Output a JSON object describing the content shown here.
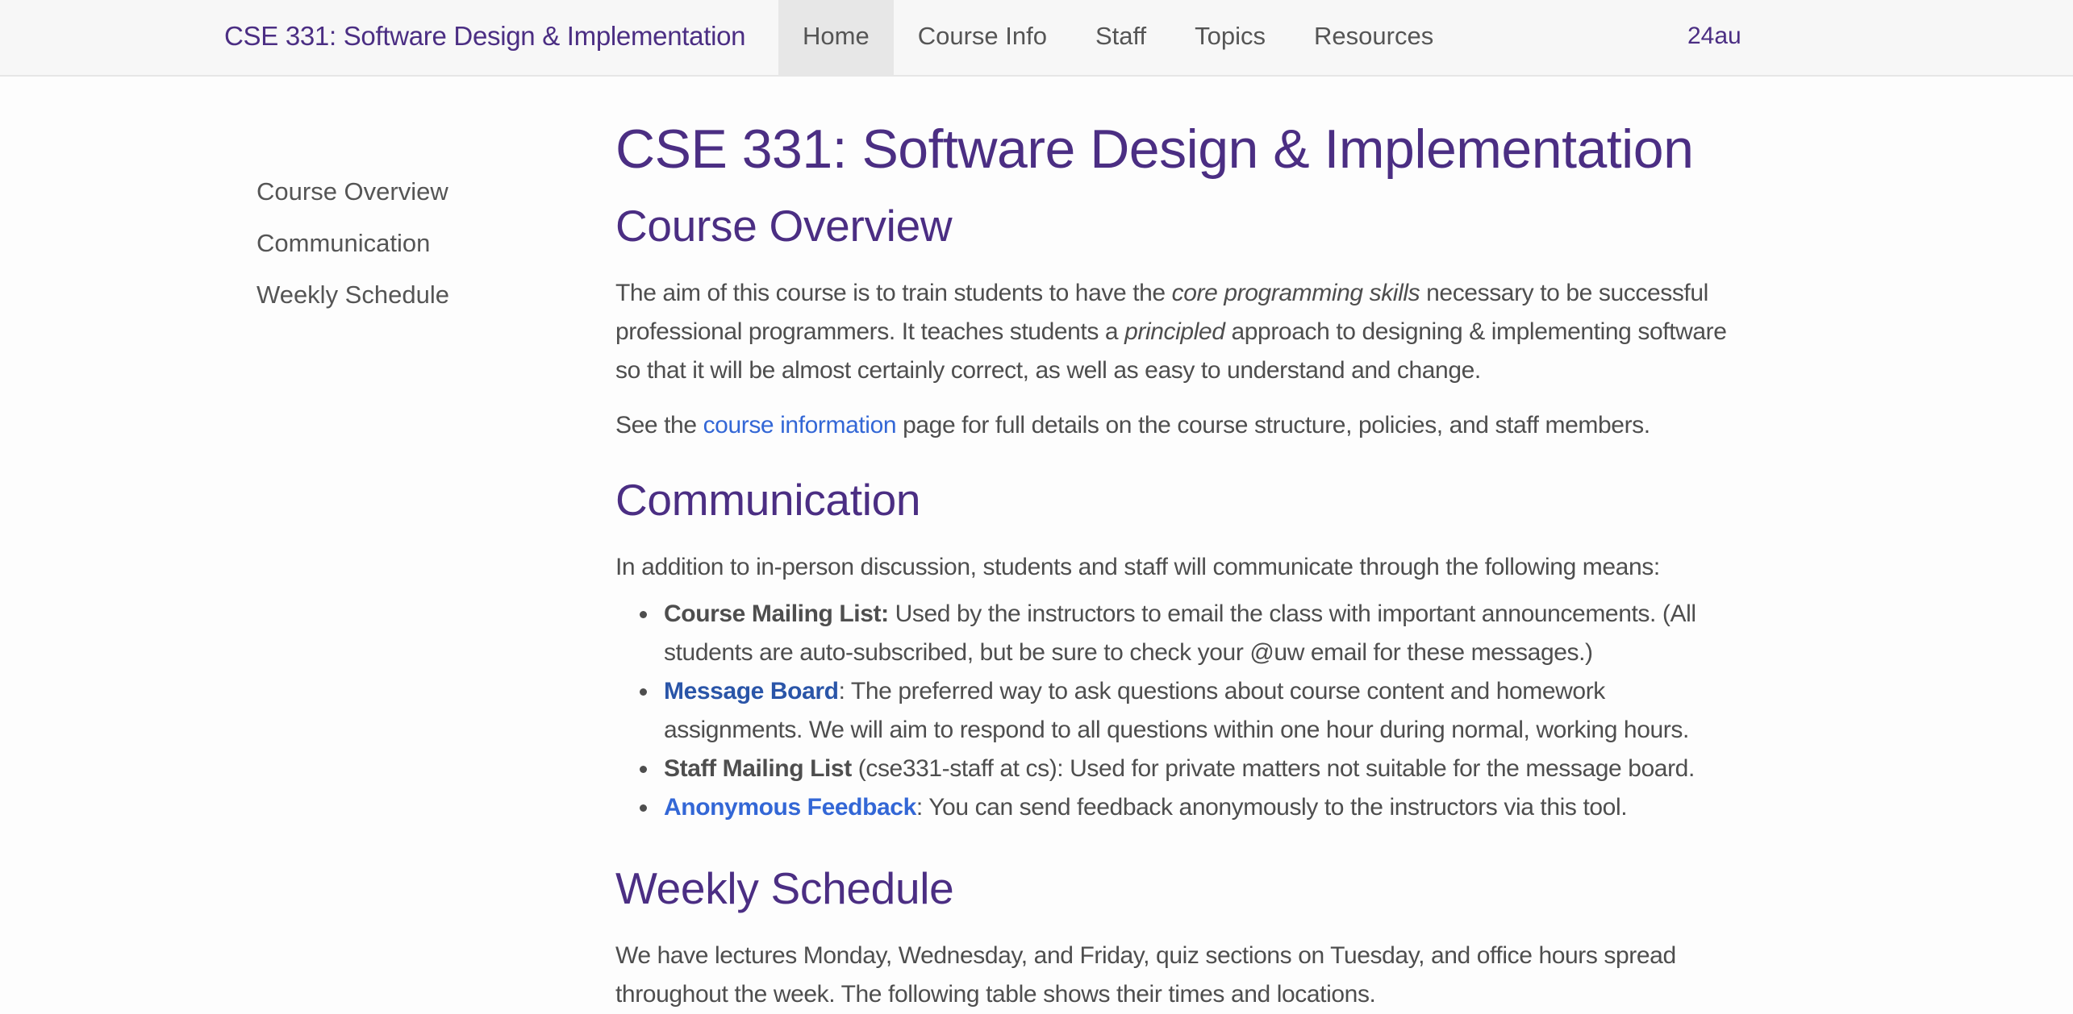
{
  "navbar": {
    "brand": "CSE 331: Software Design & Implementation",
    "links": [
      {
        "label": "Home",
        "active": true
      },
      {
        "label": "Course Info",
        "active": false
      },
      {
        "label": "Staff",
        "active": false
      },
      {
        "label": "Topics",
        "active": false
      },
      {
        "label": "Resources",
        "active": false
      }
    ],
    "term": "24au"
  },
  "sidenav": {
    "items": [
      {
        "label": "Course Overview"
      },
      {
        "label": "Communication"
      },
      {
        "label": "Weekly Schedule"
      }
    ]
  },
  "main": {
    "title": "CSE 331: Software Design & Implementation",
    "overview": {
      "heading": "Course Overview",
      "p1": {
        "t1": "The aim of this course is to train students to have the ",
        "em1": "core programming skills",
        "t2": " necessary to be successful professional programmers. It teaches students a ",
        "em2": "principled",
        "t3": " approach to designing & implementing software so that it will be almost certainly correct, as well as easy to understand and change."
      },
      "p2": {
        "t1": "See the ",
        "link": "course information",
        "t2": " page for full details on the course structure, policies, and staff members."
      }
    },
    "communication": {
      "heading": "Communication",
      "intro": "In addition to in-person discussion, students and staff will communicate through the following means:",
      "items": [
        {
          "label": "Course Mailing List:",
          "text": " Used by the instructors to email the class with important announcements. (All students are auto-subscribed, but be sure to check your @uw email for these messages.)"
        },
        {
          "label": "Message Board",
          "text": ": The preferred way to ask questions about course content and homework assignments. We will aim to respond to all questions within one hour during normal, working hours."
        },
        {
          "label": "Staff Mailing List",
          "text": " (cse331-staff at cs): Used for private matters not suitable for the message board."
        },
        {
          "label": "Anonymous Feedback",
          "text": ": You can send feedback anonymously to the instructors via this tool."
        }
      ]
    },
    "schedule": {
      "heading": "Weekly Schedule",
      "intro": "We have lectures Monday, Wednesday, and Friday, quiz sections on Tuesday, and office hours spread throughout the week. The following table shows their times and locations."
    }
  },
  "colors": {
    "brand_purple": "#4b2e83",
    "link_blue": "#3367d6",
    "text_gray": "#4e4e4e",
    "navbar_bg": "#f7f7f7",
    "active_tab_bg": "#e7e7e7"
  }
}
